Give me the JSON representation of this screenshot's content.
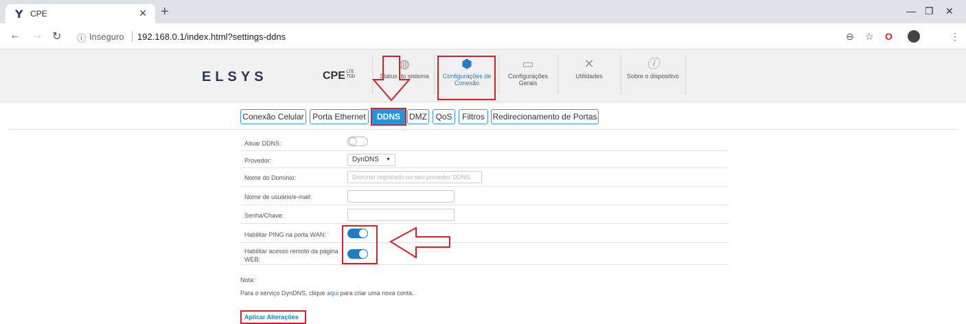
{
  "browser": {
    "tab_title": "CPE",
    "tab_favicon": "Y",
    "new_tab": "+",
    "insecure_label": "Inseguro",
    "url": "192.168.0.1/index.html?settings-ddns"
  },
  "header": {
    "logo": "ELSYS",
    "product": "CPE",
    "product_sub_1": "LTE",
    "product_sub_2": "TDD",
    "menu": [
      {
        "label": "Status do sistema",
        "icon": "globe-icon"
      },
      {
        "label": "Configurações de Conexão",
        "icon": "gear-icon",
        "active": true
      },
      {
        "label": "Configurações Gerais",
        "icon": "router-icon"
      },
      {
        "label": "Utilidades",
        "icon": "tools-icon"
      },
      {
        "label": "Sobre o dispositivo",
        "icon": "info-icon"
      }
    ]
  },
  "subtabs": [
    {
      "label": "Conexão Celular"
    },
    {
      "label": "Porta Ethernet"
    },
    {
      "label": "DDNS",
      "active": true
    },
    {
      "label": "DMZ"
    },
    {
      "label": "QoS"
    },
    {
      "label": "Filtros"
    },
    {
      "label": "Redirecionamento de Portas"
    }
  ],
  "form": {
    "enable_ddns": {
      "label": "Ativar DDNS:",
      "on": false
    },
    "provider": {
      "label": "Provedor:",
      "value": "DynDNS"
    },
    "domain": {
      "label": "Nome do Domínio:",
      "placeholder": "Domínio registrado no seu provedor DDNS",
      "value": ""
    },
    "user": {
      "label": "Nome de usuário/e-mail:",
      "value": ""
    },
    "password": {
      "label": "Senha/Chave:",
      "value": ""
    },
    "ping_wan": {
      "label": "Habilitar PING na porta WAN:",
      "on": true
    },
    "remote_web": {
      "label": "Habilitar acesso remoto da página WEB:",
      "on": true
    }
  },
  "note": {
    "title": "Nota:",
    "text_before": "Para o serviço DynDNS, clique ",
    "link": "aqui",
    "text_after": " para criar uma nova conta."
  },
  "apply_label": "Aplicar Alterações",
  "colors": {
    "accent": "#1e7ec8",
    "highlight": "#d4202a"
  }
}
